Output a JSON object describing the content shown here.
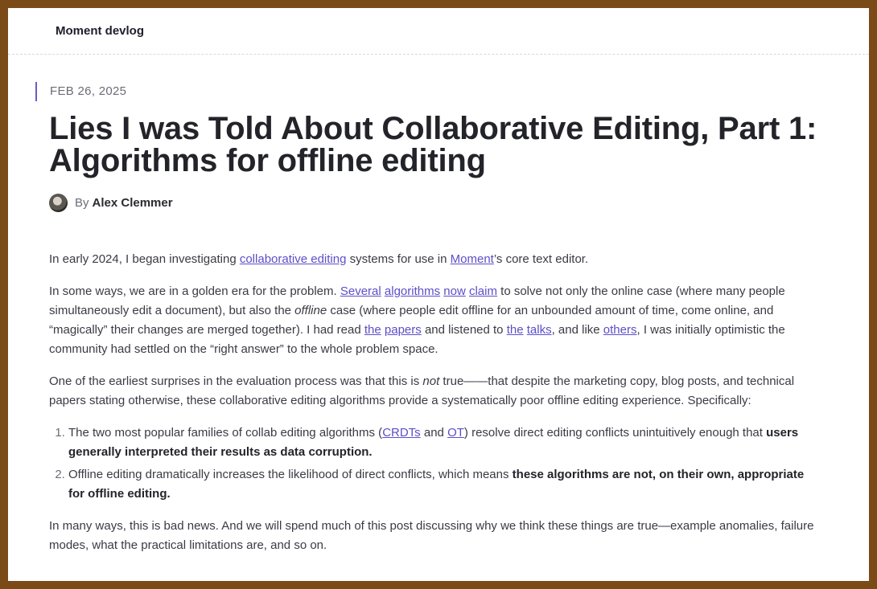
{
  "site": {
    "title": "Moment devlog"
  },
  "post": {
    "date": "FEB 26, 2025",
    "title": "Lies I was Told About Collaborative Editing, Part 1: Algorithms for offline editing",
    "by_label": "By",
    "author": "Alex Clemmer"
  },
  "p1": {
    "t1": "In early 2024, I began investigating ",
    "link1": "collaborative editing",
    "t2": " systems for use in ",
    "link2": "Moment",
    "t3": "’s core text editor."
  },
  "p2": {
    "t1": "In some ways, we are in a golden era for the problem. ",
    "links_a": [
      "Several",
      "algorithms",
      "now",
      "claim"
    ],
    "t2": " to solve not only the online case (where many people simultaneously edit a document), but also the ",
    "em": "offline",
    "t3": " case (where people edit offline for an unbounded amount of time, come online, and “magically” their changes are merged together). I had read ",
    "links_b": [
      "the",
      "papers"
    ],
    "t4": " and listened to ",
    "links_c": [
      "the",
      "talks"
    ],
    "t5": ", and like ",
    "link_d": "others",
    "t6": ", I was initially optimistic the community had settled on the “right answer” to the whole problem space."
  },
  "p3": {
    "t1": "One of the earliest surprises in the evaluation process was that this is ",
    "em": "not",
    "t2": " true——that despite the marketing copy, blog posts, and technical papers stating otherwise, these collaborative editing algorithms provide a systematically poor offline editing experience. Specifically:"
  },
  "list": {
    "item1": {
      "t1": "The two most popular families of collab editing algorithms (",
      "link1": "CRDTs",
      "t2": " and ",
      "link2": "OT",
      "t3": ") resolve direct editing conflicts unintuitively enough that ",
      "bold": "users generally interpreted their results as data corruption."
    },
    "item2": {
      "t1": "Offline editing dramatically increases the likelihood of direct conflicts, which means ",
      "bold": "these algorithms are not, on their own, appropriate for offline editing."
    }
  },
  "p4": {
    "t1": "In many ways, this is bad news. And we will spend much of this post discussing why we think these things are true—example anomalies, failure modes, what the practical limitations are, and so on."
  }
}
